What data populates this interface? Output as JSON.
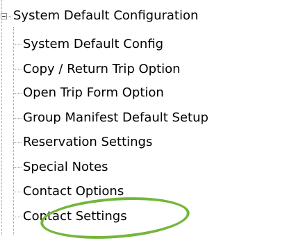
{
  "tree": {
    "root_label": "System Default Configuration",
    "items": [
      {
        "label": "System Default Config"
      },
      {
        "label": "Copy / Return Trip Option"
      },
      {
        "label": "Open Trip Form Option"
      },
      {
        "label": "Group Manifest Default Setup"
      },
      {
        "label": "Reservation Settings"
      },
      {
        "label": "Special Notes"
      },
      {
        "label": "Contact Options"
      },
      {
        "label": "Contact Settings"
      }
    ]
  },
  "colors": {
    "highlight_ring": "#74b63b",
    "tree_line": "#a0a0a0"
  }
}
